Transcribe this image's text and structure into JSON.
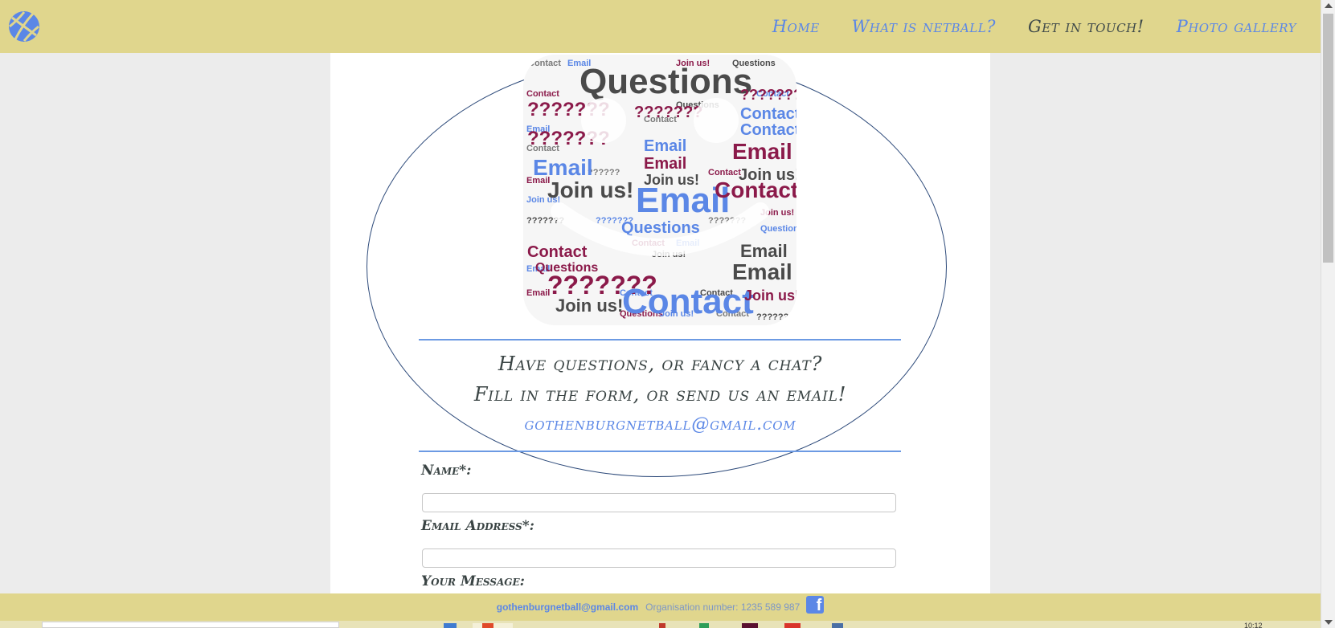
{
  "nav": {
    "logo_icon": "netball-icon",
    "links": [
      "Home",
      "What is netball?",
      "Get in touch!",
      "Photo gallery"
    ],
    "active": "Get in touch!"
  },
  "hero": {
    "wordcloud_words": [
      "Questions",
      "Email",
      "Contact",
      "Join us!",
      "???????"
    ],
    "line1": "Have questions, or fancy a chat?",
    "line2": "Fill in the form, or send us an email!",
    "email": "gothenburgnetball@gmail.com"
  },
  "form": {
    "name_label": "Name*:",
    "email_label": "Email Address*:",
    "message_label": "Your Message:",
    "name_value": "",
    "email_value": ""
  },
  "footer": {
    "email": "gothenburgnetball@gmail.com",
    "org": "Organisation number: 1235 589 987",
    "social_icon": "facebook-icon"
  },
  "taskbar": {
    "clock": "10:12"
  },
  "colors": {
    "bar": "#e0d68d",
    "link": "#5b87e6",
    "text": "#3a4444",
    "accent_maroon": "#8b1a4a"
  }
}
